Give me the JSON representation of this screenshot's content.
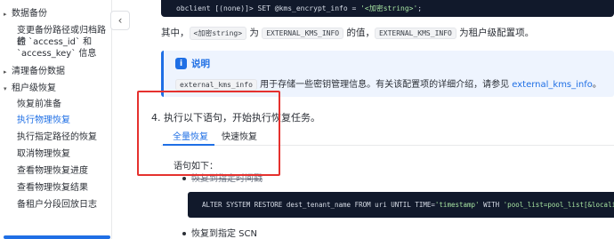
{
  "sidebar": {
    "items": [
      {
        "label": "数据备份",
        "level": "top"
      },
      {
        "label": "变更备份路径或归档路径",
        "level": "sub"
      },
      {
        "label": "的 `access_id` 和",
        "level": "sub"
      },
      {
        "label": "`access_key` 信息",
        "level": "sub"
      },
      {
        "label": "清理备份数据",
        "level": "top"
      },
      {
        "label": "租户级恢复",
        "level": "top"
      },
      {
        "label": "恢复前准备",
        "level": "sub"
      },
      {
        "label": "执行物理恢复",
        "level": "sub",
        "active": true
      },
      {
        "label": "执行指定路径的恢复",
        "level": "sub"
      },
      {
        "label": "取消物理恢复",
        "level": "sub"
      },
      {
        "label": "查看物理恢复进度",
        "level": "sub"
      },
      {
        "label": "查看物理恢复结果",
        "level": "sub"
      },
      {
        "label": "备租户分段回放日志",
        "level": "sub"
      }
    ],
    "collapse_icon": "chevron-left-icon"
  },
  "code_top": {
    "prefix": "obclient [(none)]> SET @kms_encrypt_info = ",
    "string": "'<加密string>'",
    "suffix": ";"
  },
  "paragraph": {
    "prefix": "其中，",
    "tag1": "<加密string>",
    "middle": " 为 ",
    "tag2": "EXTERNAL_KMS_INFO",
    "middle2": " 的值，",
    "tag3": "EXTERNAL_KMS_INFO",
    "suffix": " 为租户级配置项。"
  },
  "note": {
    "title": "说明",
    "icon": "info-icon",
    "tag": "external_kms_info",
    "text": " 用于存储一些密钥管理信息。有关该配置项的详细介绍，请参见 ",
    "link": "external_kms_info",
    "end": "。"
  },
  "step": {
    "text": "4. 执行以下语句，开始执行恢复任务。"
  },
  "tabs": [
    {
      "label": "全量恢复",
      "active": true
    },
    {
      "label": "快速恢复",
      "active": false
    }
  ],
  "content": {
    "label": "语句如下：",
    "bullet1": "恢复到指定时间戳",
    "bullet2": "恢复到指定 SCN"
  },
  "code_block": {
    "prefix": "ALTER SYSTEM RESTORE dest_tenant_name FROM uri UNTIL TIME=",
    "string": "'timestamp'",
    "middle": " WITH ",
    "string2": "'pool_list=pool_list[&locality=lo"
  },
  "colors": {
    "accent": "#1f6fe5",
    "highlight": "#e5312e",
    "code_bg": "#11192b"
  }
}
